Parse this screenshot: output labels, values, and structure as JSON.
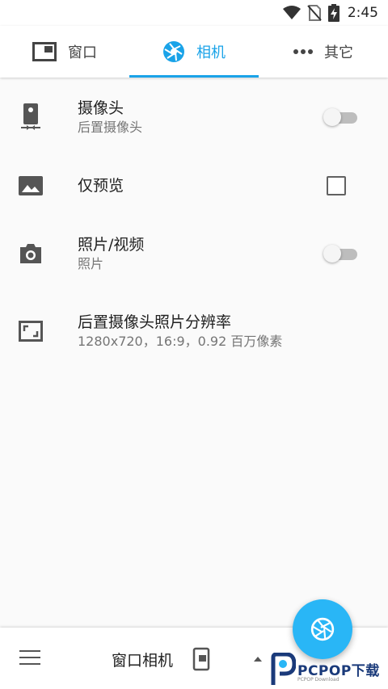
{
  "status": {
    "time": "2:45"
  },
  "tabs": [
    {
      "label": "窗口",
      "icon": "window-icon"
    },
    {
      "label": "相机",
      "icon": "aperture-icon"
    },
    {
      "label": "其它",
      "icon": "more-dots-icon"
    }
  ],
  "settings": [
    {
      "title": "摄像头",
      "subtitle": "后置摄像头",
      "icon": "camera-switch-phone-icon",
      "control": "switch",
      "on": false
    },
    {
      "title": "仅预览",
      "icon": "image-icon",
      "control": "checkbox",
      "checked": false
    },
    {
      "title": "照片/视频",
      "subtitle": "照片",
      "icon": "camera-icon",
      "control": "switch",
      "on": false
    },
    {
      "title": "后置摄像头照片分辨率",
      "subtitle": "1280x720，16:9，0.92 百万像素",
      "icon": "aspect-ratio-icon"
    }
  ],
  "bottom": {
    "title": "窗口相机"
  },
  "watermark": {
    "text": "PCPOP下载",
    "small": "PCPOP Download"
  },
  "colors": {
    "accent": "#1aa3e8",
    "fab": "#29b6f6"
  }
}
